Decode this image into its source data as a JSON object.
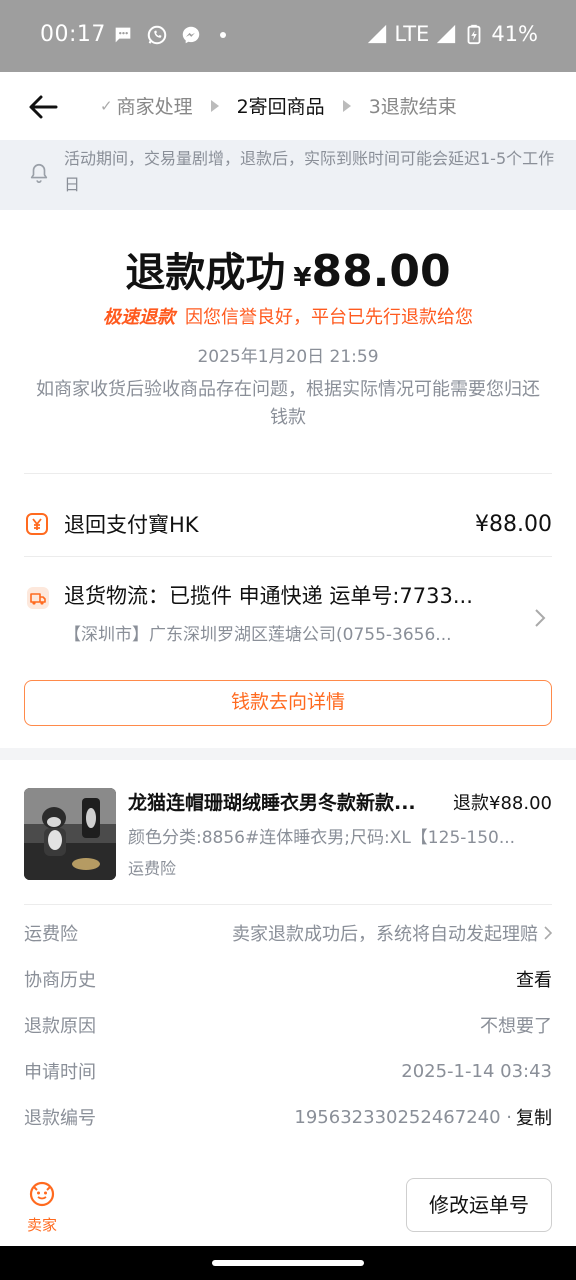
{
  "status_bar": {
    "time": "00:17",
    "network": "LTE",
    "battery": "41%",
    "notification_icons": [
      "chat-bubble-icon",
      "whatsapp-icon",
      "messenger-icon"
    ]
  },
  "nav": {
    "steps": [
      {
        "label": "商家处理",
        "state": "done"
      },
      {
        "label": "2寄回商品",
        "state": "active"
      },
      {
        "label": "3退款结束",
        "state": "todo"
      }
    ]
  },
  "notice": {
    "text": "活动期间，交易量剧增，退款后，实际到账时间可能会延迟1-5个工作日"
  },
  "refund": {
    "status": "退款成功",
    "currency": "¥",
    "amount": "88.00",
    "fast_badge": "极速退款",
    "fast_message": "因您信誉良好，平台已先行退款给您",
    "date": "2025年1月20日 21:59",
    "description": "如商家收货后验收商品存在问题，根据实际情况可能需要您归还钱款"
  },
  "payment": {
    "label": "退回支付寶HK",
    "value": "¥88.00"
  },
  "logistics": {
    "line1": "退货物流：已揽件 申通快递 运单号:7733...",
    "line2": "【深圳市】广东深圳罗湖区莲塘公司(0755-3656..."
  },
  "money_button": "钱款去向详情",
  "product": {
    "title": "龙猫连帽珊瑚绒睡衣男冬款新款...",
    "refund": "退款¥88.00",
    "spec": "颜色分类:8856#连体睡衣男;尺码:XL【125-150...",
    "insurance": "运费险"
  },
  "info": [
    {
      "key": "运费险",
      "value": "卖家退款成功后，系统将自动发起理赔",
      "chevron": true
    },
    {
      "key": "协商历史",
      "value": "查看",
      "dark": true
    },
    {
      "key": "退款原因",
      "value": "不想要了"
    },
    {
      "key": "申请时间",
      "value": "2025-1-14 03:43"
    },
    {
      "key": "退款编号",
      "value": "195632330252467240 ·",
      "copy": "复制"
    }
  ],
  "bottom": {
    "seller_label": "卖家",
    "edit_button": "修改运单号"
  },
  "colors": {
    "accent": "#ff6a1f",
    "muted": "#8a8f98",
    "status_bar": "#9e9e9e"
  }
}
